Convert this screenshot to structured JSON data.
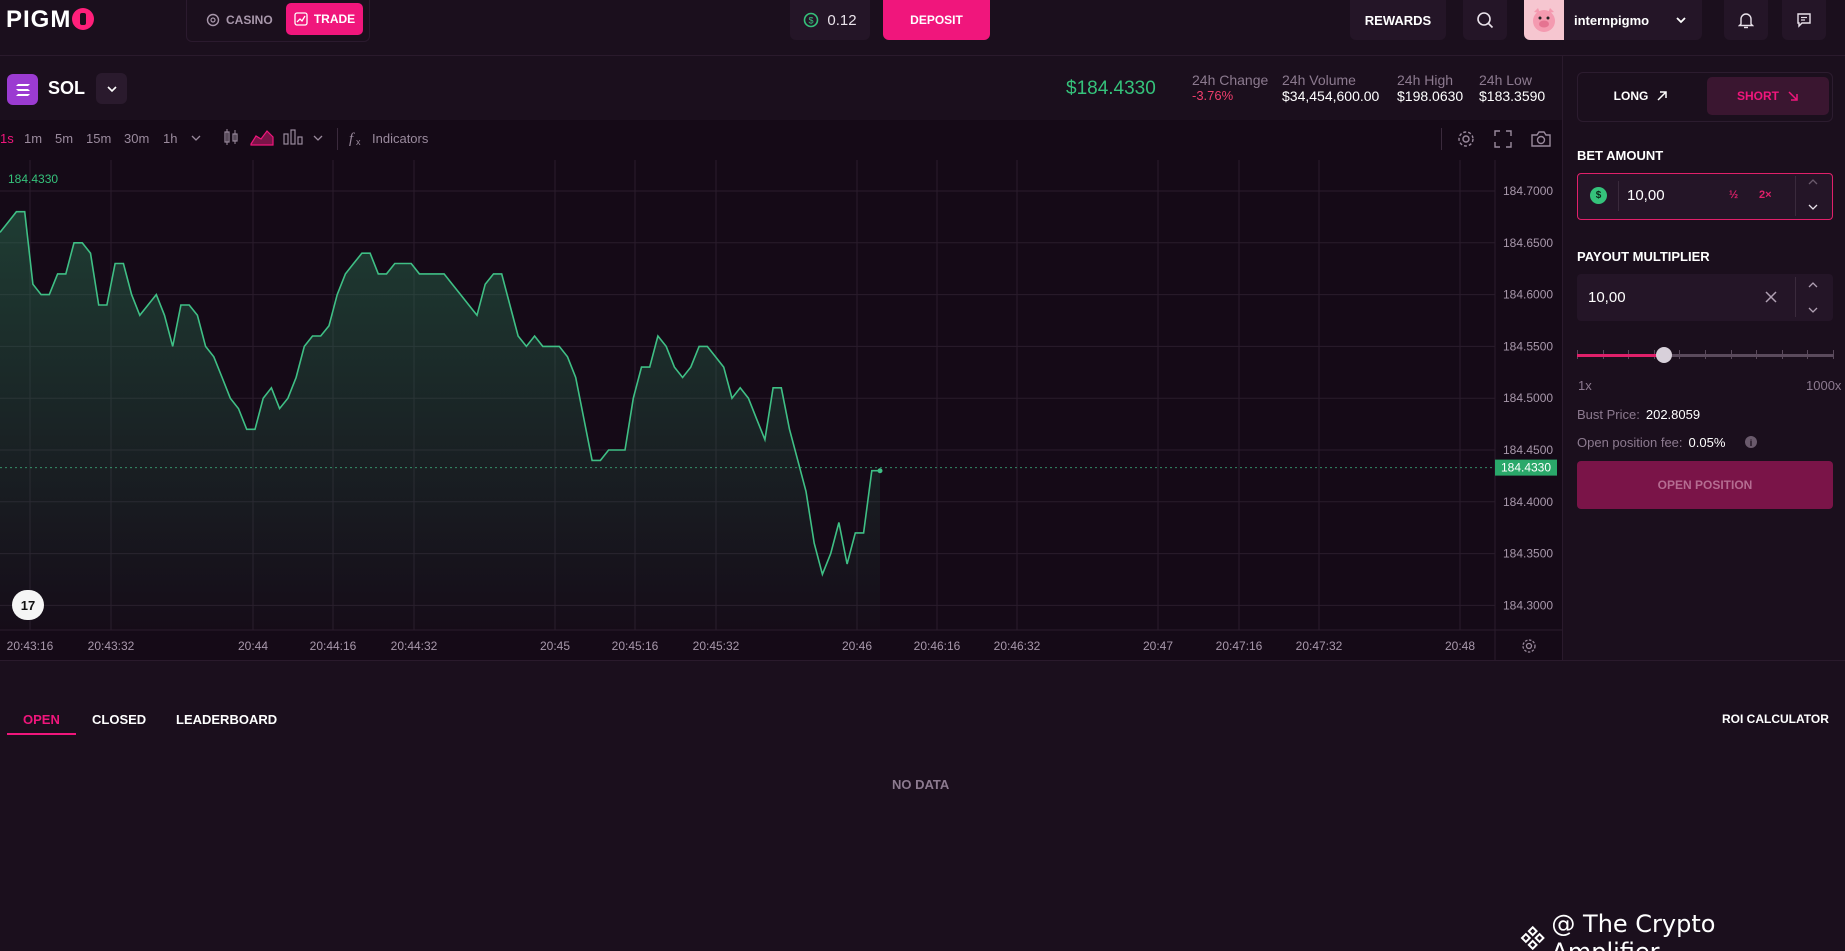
{
  "header": {
    "logo_text": "PIGMO",
    "casino_label": "CASINO",
    "trade_label": "TRADE",
    "balance": "0.12",
    "deposit_label": "DEPOSIT",
    "rewards_label": "REWARDS",
    "username": "internpigmo"
  },
  "symbol": {
    "name": "SOL",
    "price": "$184.4330",
    "stats": [
      {
        "label": "24h Change",
        "value": "-3.76%"
      },
      {
        "label": "24h Volume",
        "value": "$34,454,600.00"
      },
      {
        "label": "24h High",
        "value": "$198.0630"
      },
      {
        "label": "24h Low",
        "value": "$183.3590"
      }
    ]
  },
  "toolbar": {
    "intervals": [
      "1s",
      "1m",
      "5m",
      "15m",
      "30m",
      "1h"
    ],
    "indicators_label": "Indicators"
  },
  "chart_data": {
    "type": "area",
    "last_price_label": "184.4330",
    "current_price_tag": "184.4330",
    "y_ticks": [
      "184.7000",
      "184.6500",
      "184.6000",
      "184.5500",
      "184.5000",
      "184.4500",
      "184.4000",
      "184.3500",
      "184.3000"
    ],
    "x_ticks": [
      "20:43:16",
      "20:43:32",
      "20:44",
      "20:44:16",
      "20:44:32",
      "20:45",
      "20:45:16",
      "20:45:32",
      "20:46",
      "20:46:16",
      "20:46:32",
      "20:47",
      "20:47:16",
      "20:47:32",
      "20:48"
    ],
    "ylim": [
      184.28,
      184.72
    ],
    "values": [
      184.66,
      184.67,
      184.68,
      184.68,
      184.61,
      184.6,
      184.6,
      184.62,
      184.62,
      184.65,
      184.65,
      184.64,
      184.59,
      184.59,
      184.63,
      184.63,
      184.6,
      184.58,
      184.59,
      184.6,
      184.58,
      184.55,
      184.59,
      184.59,
      184.58,
      184.55,
      184.54,
      184.52,
      184.5,
      184.49,
      184.47,
      184.47,
      184.5,
      184.51,
      184.49,
      184.5,
      184.52,
      184.55,
      184.56,
      184.56,
      184.57,
      184.6,
      184.62,
      184.63,
      184.64,
      184.64,
      184.62,
      184.62,
      184.63,
      184.63,
      184.63,
      184.62,
      184.62,
      184.62,
      184.62,
      184.61,
      184.6,
      184.59,
      184.58,
      184.61,
      184.62,
      184.62,
      184.59,
      184.56,
      184.55,
      184.56,
      184.55,
      184.55,
      184.55,
      184.54,
      184.52,
      184.48,
      184.44,
      184.44,
      184.45,
      184.45,
      184.45,
      184.5,
      184.53,
      184.53,
      184.56,
      184.55,
      184.53,
      184.52,
      184.53,
      184.55,
      184.55,
      184.54,
      184.53,
      184.5,
      184.51,
      184.5,
      184.48,
      184.46,
      184.51,
      184.51,
      184.47,
      184.44,
      184.41,
      184.36,
      184.33,
      184.35,
      184.38,
      184.34,
      184.37,
      184.37,
      184.43,
      184.43
    ]
  },
  "order_panel": {
    "long_label": "LONG",
    "short_label": "SHORT",
    "bet_amount_label": "BET AMOUNT",
    "bet_amount_value": "10,00",
    "half_label": "½",
    "double_label": "2×",
    "payout_label": "PAYOUT MULTIPLIER",
    "payout_value": "10,00",
    "multiplier_fraction": 0.34,
    "range_min": "1x",
    "range_max": "1000x",
    "bust_label": "Bust Price:",
    "bust_value": "202.8059",
    "fee_label": "Open position fee:",
    "fee_value": "0.05%",
    "open_position_label": "OPEN POSITION"
  },
  "positions": {
    "tabs": [
      "OPEN",
      "CLOSED",
      "LEADERBOARD"
    ],
    "roi_label": "ROI CALCULATOR",
    "empty_label": "NO DATA"
  },
  "watermark": "@ The Crypto Amplifier..."
}
